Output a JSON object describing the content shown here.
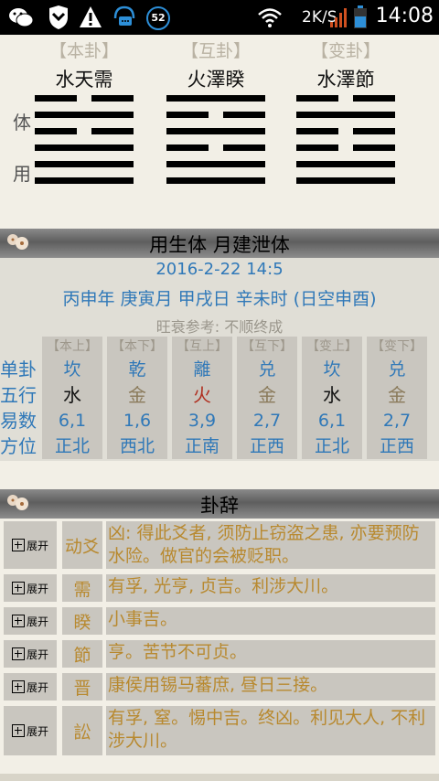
{
  "status_bar": {
    "battery_level": "52",
    "net_speed": "2K/S",
    "time": "14:08",
    "icons": [
      "wechat-icon",
      "shield-icon",
      "warning-icon",
      "chat-headset-icon",
      "battery-icon",
      "wifi-icon",
      "signal-icon"
    ]
  },
  "hexagrams": [
    {
      "head": "【本卦】",
      "name": "水天需",
      "lines": [
        0,
        1,
        0,
        1,
        1,
        1
      ]
    },
    {
      "head": "【互卦】",
      "name": "火澤睽",
      "lines": [
        1,
        0,
        1,
        0,
        1,
        1
      ]
    },
    {
      "head": "【变卦】",
      "name": "水澤節",
      "lines": [
        0,
        1,
        0,
        0,
        1,
        1
      ]
    }
  ],
  "side_labels": {
    "ti": "体",
    "yong": "用"
  },
  "relation_banner": "用生体  月建泄体",
  "info": {
    "date": "2016-2-22 14:5",
    "ganzhi": "丙申年  庚寅月  甲戌日  辛未时  (日空申酉)",
    "wangshuai": "旺衰参考: 不顺终成"
  },
  "row_labels": [
    "单卦",
    "五行",
    "易数",
    "方位"
  ],
  "columns": [
    {
      "head": "【本上】",
      "gua": "坎",
      "wuxing": "水",
      "wx_color": "#111111",
      "num": "6,1",
      "dir": "正北"
    },
    {
      "head": "【本下】",
      "gua": "乾",
      "wuxing": "金",
      "wx_color": "#8a7a5a",
      "num": "1,6",
      "dir": "西北"
    },
    {
      "head": "【互上】",
      "gua": "離",
      "wuxing": "火",
      "wx_color": "#b03020",
      "num": "3,9",
      "dir": "正南"
    },
    {
      "head": "【互下】",
      "gua": "兑",
      "wuxing": "金",
      "wx_color": "#8a7a5a",
      "num": "2,7",
      "dir": "正西"
    },
    {
      "head": "【变上】",
      "gua": "坎",
      "wuxing": "水",
      "wx_color": "#111111",
      "num": "6,1",
      "dir": "正北"
    },
    {
      "head": "【变下】",
      "gua": "兑",
      "wuxing": "金",
      "wx_color": "#8a7a5a",
      "num": "2,7",
      "dir": "正西"
    }
  ],
  "guaci_banner": "卦辞",
  "expand_label": "展开",
  "guaci": [
    {
      "name": "动爻",
      "text": "凶: 得此爻者, 须防止窃盗之患, 亦要预防水险。做官的会被贬职。"
    },
    {
      "name": "需",
      "text": "有孚, 光亨, 贞吉。利涉大川。"
    },
    {
      "name": "睽",
      "text": "小事吉。"
    },
    {
      "name": "節",
      "text": "亨。苦节不可贞。"
    },
    {
      "name": "晋",
      "text": "康侯用锡马蕃庶, 昼日三接。"
    },
    {
      "name": "訟",
      "text": "有孚, 窒。惕中吉。终凶。利见大人, 不利涉大川。"
    }
  ]
}
